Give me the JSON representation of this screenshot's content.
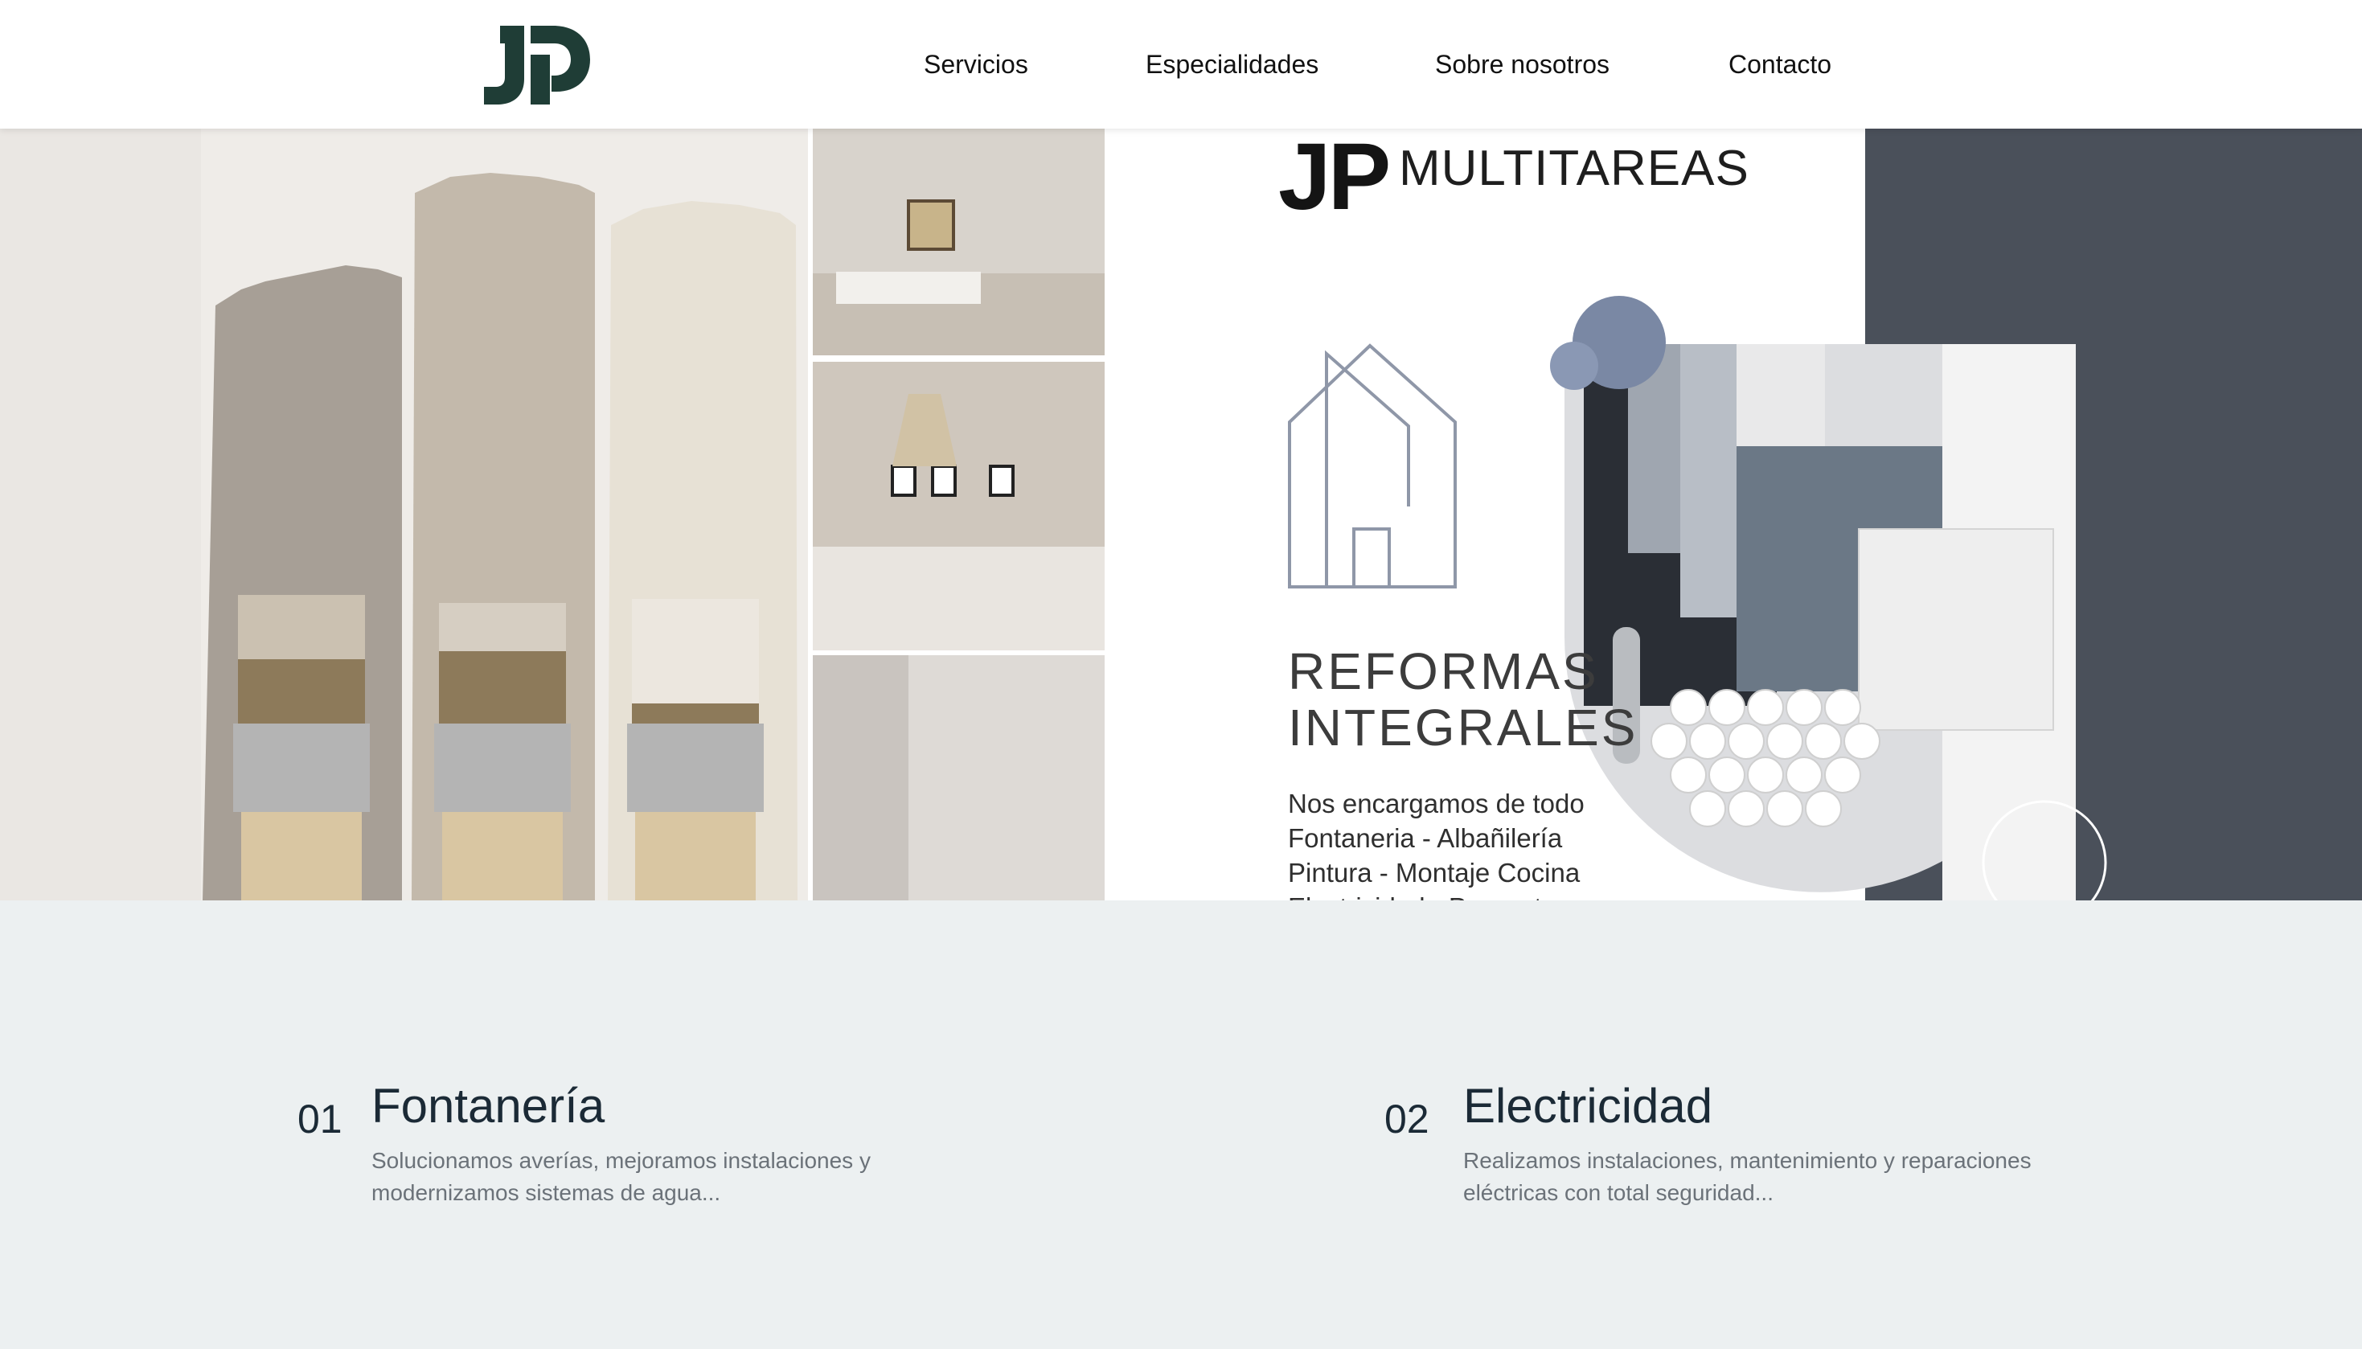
{
  "header": {
    "logo_alt": "JP",
    "nav": [
      {
        "label": "Servicios"
      },
      {
        "label": "Especialidades"
      },
      {
        "label": "Sobre nosotros"
      },
      {
        "label": "Contacto"
      }
    ]
  },
  "banner": {
    "brand_mark": "JP",
    "brand_name": "MULTITAREAS",
    "headline_line1": "REFORMAS",
    "headline_line2": "INTEGRALES",
    "services_lines": [
      "Nos encargamos de todo",
      "Fontaneria - Albañilería",
      "Pintura - Montaje Cocina",
      "Electricidad - Parquet"
    ]
  },
  "features": [
    {
      "number": "01",
      "title": "Fontanería",
      "description": "Solucionamos averías, mejoramos instalaciones y modernizamos sistemas de agua..."
    },
    {
      "number": "02",
      "title": "Electricidad",
      "description": "Realizamos instalaciones, mantenimiento y reparaciones eléctricas con total seguridad..."
    }
  ],
  "colors": {
    "brand_green": "#1f3d36",
    "page_bg": "#ecf0f1",
    "dark_panel": "#4a505a"
  }
}
